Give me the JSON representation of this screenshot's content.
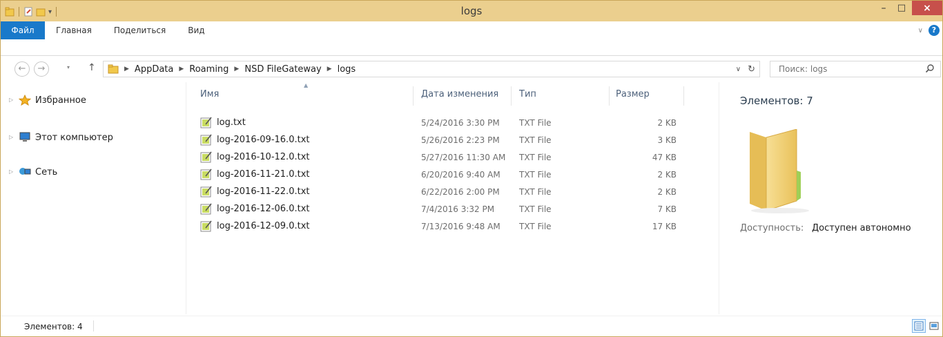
{
  "window": {
    "title": "logs",
    "controls": {
      "minimize": "–",
      "maximize": "□",
      "close": "×"
    }
  },
  "ribbon": {
    "tabs": [
      {
        "label": "Файл"
      },
      {
        "label": "Главная"
      },
      {
        "label": "Поделиться"
      },
      {
        "label": "Вид"
      }
    ],
    "help": "?"
  },
  "address": {
    "crumbs": [
      "AppData",
      "Roaming",
      "NSD FileGateway",
      "logs"
    ]
  },
  "search": {
    "placeholder": "Поиск: logs"
  },
  "nav": {
    "items": [
      {
        "label": "Избранное",
        "icon": "star-icon"
      },
      {
        "label": "Этот компьютер",
        "icon": "computer-icon"
      },
      {
        "label": "Сеть",
        "icon": "network-icon"
      }
    ]
  },
  "columns": {
    "name": "Имя",
    "date": "Дата изменения",
    "type": "Тип",
    "size": "Размер"
  },
  "files": [
    {
      "name": "log.txt",
      "date": "5/24/2016 3:30 PM",
      "type": "TXT File",
      "size": "2 KB"
    },
    {
      "name": "log-2016-09-16.0.txt",
      "date": "5/26/2016 2:23 PM",
      "type": "TXT File",
      "size": "3 KB"
    },
    {
      "name": "log-2016-10-12.0.txt",
      "date": "5/27/2016 11:30 AM",
      "type": "TXT File",
      "size": "47 KB"
    },
    {
      "name": "log-2016-11-21.0.txt",
      "date": "6/20/2016 9:40 AM",
      "type": "TXT File",
      "size": "2 KB"
    },
    {
      "name": "log-2016-11-22.0.txt",
      "date": "6/22/2016 2:00 PM",
      "type": "TXT File",
      "size": "2 KB"
    },
    {
      "name": "log-2016-12-06.0.txt",
      "date": "7/4/2016 3:32 PM",
      "type": "TXT File",
      "size": "7 KB"
    },
    {
      "name": "log-2016-12-09.0.txt",
      "date": "7/13/2016 9:48 AM",
      "type": "TXT File",
      "size": "17 KB"
    }
  ],
  "details": {
    "count": "Элементов: 7",
    "availability_label": "Доступность:",
    "availability_value": "Доступен автономно"
  },
  "status": {
    "count": "Элементов: 4"
  },
  "colors": {
    "titlebar": "#ebcf8e",
    "accent": "#1979ca",
    "close": "#c7504b"
  }
}
